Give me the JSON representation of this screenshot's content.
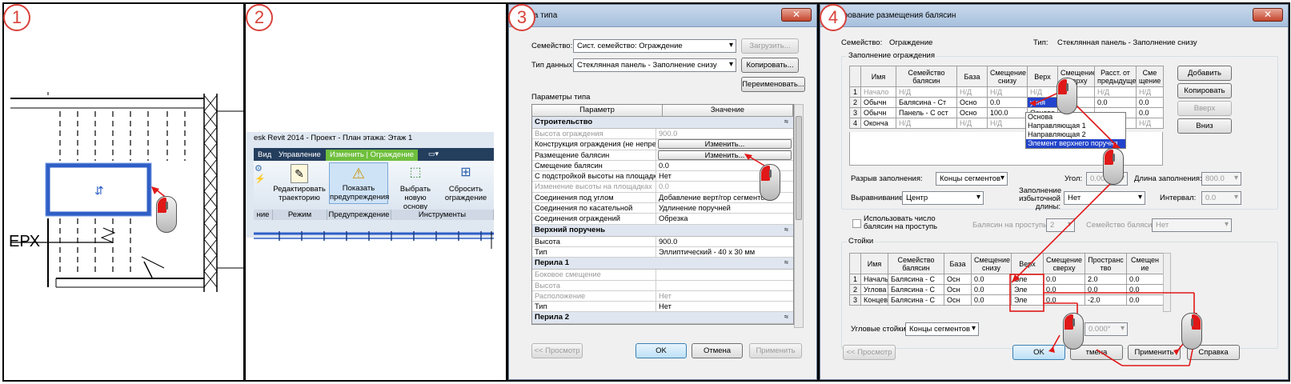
{
  "steps": [
    "1",
    "2",
    "3",
    "4"
  ],
  "panel1": {
    "label": "ЕРХ"
  },
  "panel2": {
    "title_bar": "esk Revit 2014 -    Проект - План этажа: Этаж 1",
    "tabs": [
      "Вид",
      "Управление",
      "Изменить | Ограждение"
    ],
    "buttons": [
      {
        "label": "Редактировать траекторию"
      },
      {
        "label": "Показать предупреждения"
      },
      {
        "label": "Выбрать новую основу"
      },
      {
        "label": "Сбросить ограждение"
      }
    ],
    "groups": [
      "ние",
      "Режим",
      "Предупреждение",
      "Инструменты"
    ]
  },
  "dialog3": {
    "title": "ства типа",
    "family_label": "Семейство:",
    "family_value": "Сист. семейство: Ограждение",
    "type_label": "Тип данных:",
    "type_value": "Стеклянная панель - Заполнение снизу",
    "load_btn": "Загрузить...",
    "copy_btn": "Копировать...",
    "rename_btn": "Переименовать...",
    "params_label": "Параметры типа",
    "col_param": "Параметр",
    "col_value": "Значение",
    "sections": [
      {
        "name": "Строительство",
        "rows": [
          {
            "p": "Высота ограждения",
            "v": "900.0",
            "dim": true
          },
          {
            "p": "Конструкция ограждения (не непре",
            "v": "Изменить...",
            "btn": true
          },
          {
            "p": "Размещение балясин",
            "v": "Изменить...",
            "btn": true
          },
          {
            "p": "Смещение балясин",
            "v": "0.0"
          },
          {
            "p": "С подстройкой высоты на площадк",
            "v": "Нет"
          },
          {
            "p": "Изменение высоты на площадках",
            "v": "0.0",
            "dim": true
          },
          {
            "p": "Соединения под углом",
            "v": "Добавление верт/гор сегментов"
          },
          {
            "p": "Соединения по касательной",
            "v": "Удлинение поручней"
          },
          {
            "p": "Соединения ограждений",
            "v": "Обрезка"
          }
        ]
      },
      {
        "name": "Верхний поручень",
        "rows": [
          {
            "p": "Высота",
            "v": "900.0"
          },
          {
            "p": "Тип",
            "v": "Эллиптический - 40 x 30 мм"
          }
        ]
      },
      {
        "name": "Перила 1",
        "rows": [
          {
            "p": "Боковое смещение",
            "v": "",
            "dim": true
          },
          {
            "p": "Высота",
            "v": "",
            "dim": true
          },
          {
            "p": "Расположение",
            "v": "Нет",
            "dim": true
          },
          {
            "p": "Тип",
            "v": "Нет"
          }
        ]
      },
      {
        "name": "Перила 2",
        "rows": []
      }
    ],
    "preview_btn": "<< Просмотр",
    "ok_btn": "OK",
    "cancel_btn": "Отмена",
    "apply_btn": "Применить"
  },
  "dialog4": {
    "title": "ктирование размещения балясин",
    "family_label": "Семейство:",
    "family_value": "Ограждение",
    "type_label": "Тип:",
    "type_value": "Стеклянная панель - Заполнение снизу",
    "fill_group": "Заполнение ограждения",
    "fill_headers": [
      "",
      "Имя",
      "Семейство балясин",
      "База",
      "Смещение снизу",
      "Верх",
      "Смещение сверху",
      "Расст. от предыдущей",
      "Сме щение"
    ],
    "fill_rows": [
      [
        "1",
        "Начало",
        "Н/Д",
        "Н/Д",
        "Н/Д",
        "Н/Д",
        "Н/Д",
        "Н/Д",
        "Н/Д"
      ],
      [
        "2",
        "Обычн",
        "Балясина - Ст",
        "Осно",
        "0.0",
        "учня",
        "",
        "0.0",
        "0.0"
      ],
      [
        "3",
        "Обычн",
        "Панель - С ост",
        "Осно",
        "100.0",
        "Основа",
        "",
        "",
        "0.0"
      ],
      [
        "4",
        "Оконча",
        "Н/Д",
        "Н/Д",
        "Н/Д",
        "Направляющая 1",
        "",
        "",
        "Н/Д"
      ]
    ],
    "dropdown_options": [
      "Основа",
      "Направляющая 1",
      "Направляющая 2",
      "Элемент верхнего поручня"
    ],
    "btn_add": "Добавить",
    "btn_copy": "Копировать",
    "btn_up": "Вверх",
    "btn_down": "Вниз",
    "break_label": "Разрыв заполнения:",
    "break_value": "Концы сегментов",
    "angle_label": "Угол:",
    "angle_value": "0.000°",
    "fill_len_label": "Длина заполнения:",
    "fill_len_value": "800.0",
    "align_label": "Выравнивание:",
    "align_value": "Центр",
    "excess_label": "Заполнение избыточной длины:",
    "excess_value": "Нет",
    "interval_label": "Интервал:",
    "interval_value": "0.0",
    "use_count_label": "Использовать число балясин на проступь",
    "count_label": "Балясин на проступь:",
    "count_value": "2",
    "bal_family_label": "Семейство балясин:",
    "bal_family_value": "Нет",
    "posts_group": "Стойки",
    "posts_headers": [
      "",
      "Имя",
      "Семейство балясин",
      "База",
      "Смещение снизу",
      "Верх",
      "Смещение сверху",
      "Пространс тво",
      "Смещен ие"
    ],
    "posts_rows": [
      [
        "1",
        "Началь",
        "Балясина - С",
        "Осн",
        "0.0",
        "Эле",
        "0.0",
        "2.0",
        "0.0"
      ],
      [
        "2",
        "Углова",
        "Балясина - С",
        "Осн",
        "0.0",
        "Эле",
        "0.0",
        "0.0",
        "0.0"
      ],
      [
        "3",
        "Концев",
        "Балясина - С",
        "Осн",
        "0.0",
        "Эле",
        "0.0",
        "-2.0",
        "0.0"
      ]
    ],
    "corner_label": "Угловые стойки:",
    "corner_value": "Концы сегментов",
    "corner_angle": "0.000°",
    "preview_btn": "<< Просмотр",
    "ok_btn": "OK",
    "cancel_btn": "тмена",
    "apply_btn": "Применить",
    "help_btn": "Справка"
  }
}
